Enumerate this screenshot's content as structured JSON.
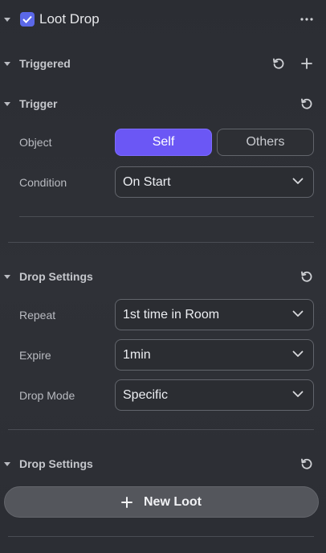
{
  "header": {
    "title": "Loot Drop",
    "checked": true
  },
  "triggered": {
    "title": "Triggered"
  },
  "trigger": {
    "title": "Trigger",
    "object_label": "Object",
    "object_options": [
      "Self",
      "Others"
    ],
    "object_selected": "Self",
    "condition_label": "Condition",
    "condition_value": "On Start"
  },
  "drop_settings": {
    "title": "Drop Settings",
    "repeat_label": "Repeat",
    "repeat_value": "1st time in Room",
    "expire_label": "Expire",
    "expire_value": "1min",
    "mode_label": "Drop Mode",
    "mode_value": "Specific"
  },
  "drop_settings_2": {
    "title": "Drop Settings",
    "new_loot_label": "New Loot"
  },
  "colors": {
    "accent": "#6b57f5",
    "checkbox": "#5b68e8"
  }
}
